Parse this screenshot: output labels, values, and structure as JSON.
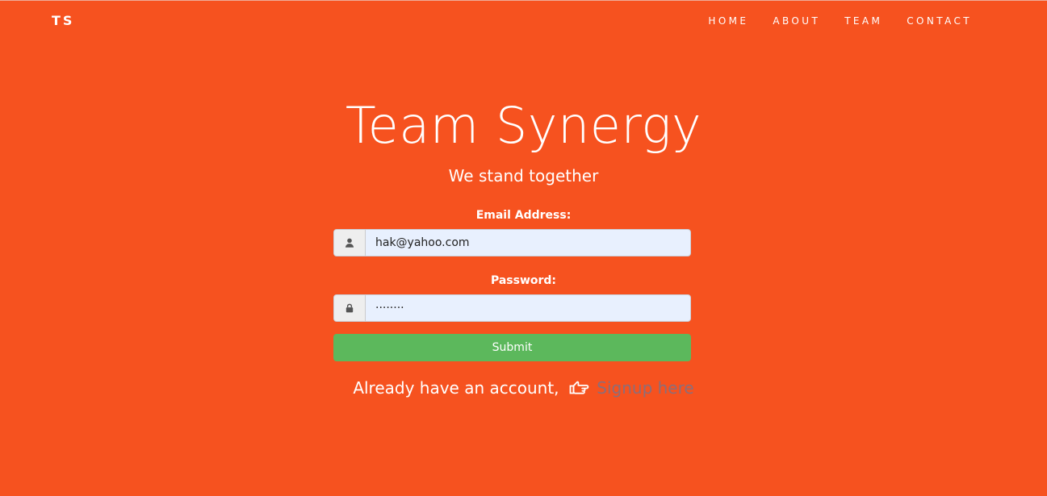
{
  "nav": {
    "brand": "TS",
    "links": [
      "HOME",
      "ABOUT",
      "TEAM",
      "CONTACT"
    ]
  },
  "hero": {
    "title": "Team Synergy",
    "subtitle": "We stand together"
  },
  "form": {
    "email": {
      "label": "Email Address:",
      "value": "hak@yahoo.com",
      "icon": "user-icon"
    },
    "password": {
      "label": "Password:",
      "masked_value": "········",
      "icon": "lock-icon"
    },
    "submit_label": "Submit"
  },
  "signup": {
    "prompt": "Already have an account,",
    "link_text": "Signup here",
    "icon": "hand-pointing-right-icon"
  },
  "colors": {
    "background": "#f6521f",
    "submit": "#5cb85c",
    "signup_link": "#8b6e7a",
    "input_background": "#e8f0fe"
  }
}
